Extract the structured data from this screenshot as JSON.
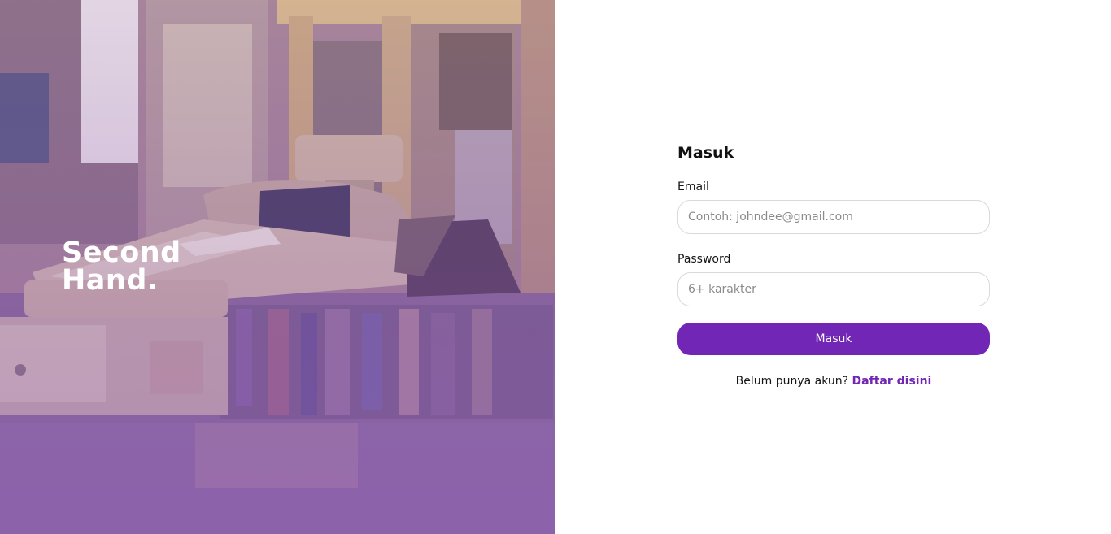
{
  "brand": {
    "line1": "Second",
    "line2": "Hand."
  },
  "login_form": {
    "title": "Masuk",
    "email_label": "Email",
    "email_placeholder": "Contoh: johndee@gmail.com",
    "email_value": "",
    "password_label": "Password",
    "password_placeholder": "6+ karakter",
    "password_value": "",
    "submit_label": "Masuk",
    "signup_prompt": "Belum punya akun?",
    "signup_link": "Daftar disini"
  },
  "colors": {
    "accent": "#7126b5",
    "hero_tint": "#8e6fa4"
  },
  "icons": {
    "hero_image": "cash-register-photo"
  }
}
